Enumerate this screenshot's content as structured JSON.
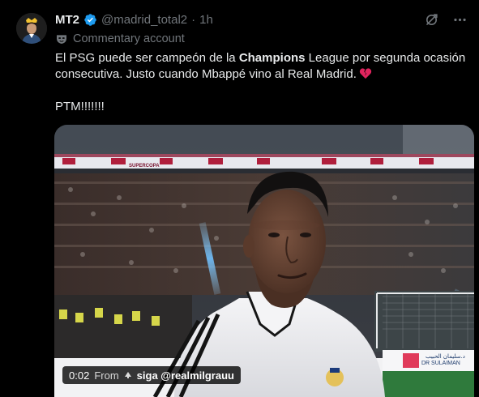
{
  "author": {
    "name": "MT2",
    "handle": "@madrid_total2",
    "separator": "·",
    "time": "1h",
    "label": "Commentary account"
  },
  "icons": {
    "verified": "verified-badge-icon",
    "grok": "grok-icon",
    "more": "more-options-icon",
    "commentary": "mask-icon",
    "heart": "broken-heart-icon"
  },
  "tweet": {
    "line1_pre": "El PSG puede ser campeón de la ",
    "line1_bold": "Champions",
    "line1_post": " League por segunda ocasión consecutiva. Justo cuando Mbappé vino al Real Madrid.",
    "line2": "PTM!!!!!!!"
  },
  "media": {
    "duration": "0:02",
    "from_label": "From",
    "source": "siga @realmilgrauu",
    "board_text": "SUPERCOPA",
    "sponsor_text": "DR SULAIMAN",
    "sponsor_arabic": "د.سليمان الحبيب"
  },
  "colors": {
    "background": "#000000",
    "text": "#e7e9ea",
    "muted": "#71767b",
    "verified": "#1d9bf0",
    "heart": "#e0245e"
  }
}
